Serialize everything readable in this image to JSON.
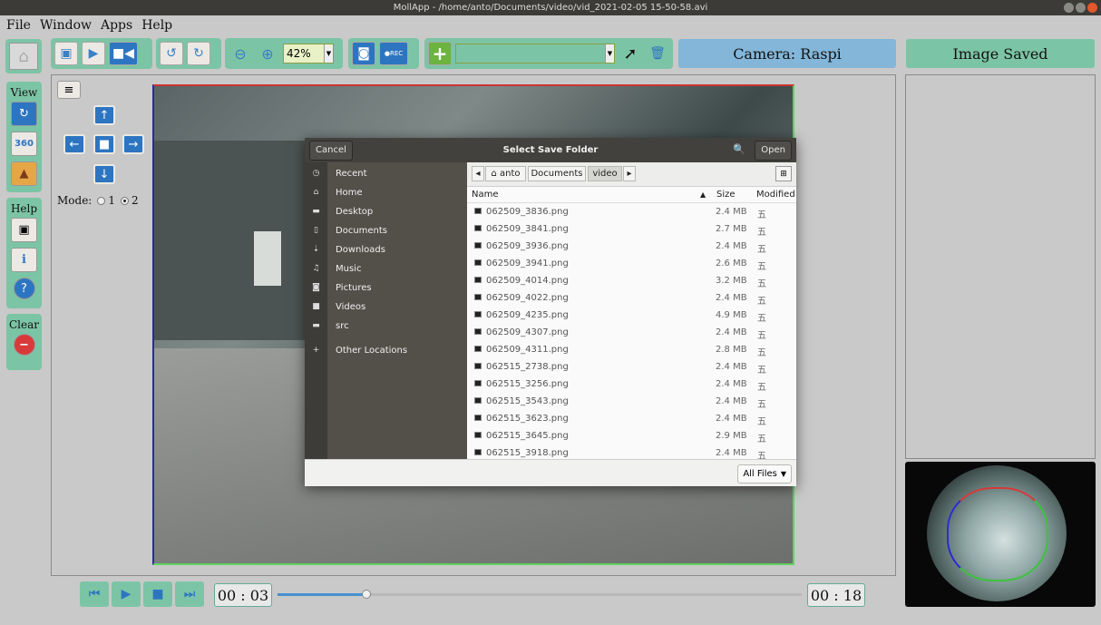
{
  "window": {
    "title": "MollApp - /home/anto/Documents/video/vid_2021-02-05 15-50-58.avi"
  },
  "menu": [
    "File",
    "Window",
    "Apps",
    "Help"
  ],
  "toolbar": {
    "zoom_value": "42%",
    "camera_label": "Camera: Raspi",
    "status_label": "Image Saved",
    "accent_color": "#7cc4a6",
    "blue_color": "#2d75c1"
  },
  "sidebar": {
    "view_title": "View",
    "help_title": "Help",
    "clear_title": "Clear",
    "badge_360": "360"
  },
  "mode": {
    "label": "Mode:",
    "option1": "1",
    "option2": "2",
    "selected": "2"
  },
  "player": {
    "current_time": "00 : 03",
    "total_time": "00 : 18",
    "progress": 0.17
  },
  "dialog": {
    "title": "Select Save Folder",
    "cancel": "Cancel",
    "open": "Open",
    "places": [
      {
        "label": "Recent",
        "icon": "clock-icon"
      },
      {
        "label": "Home",
        "icon": "home-icon"
      },
      {
        "label": "Desktop",
        "icon": "folder-icon"
      },
      {
        "label": "Documents",
        "icon": "document-icon"
      },
      {
        "label": "Downloads",
        "icon": "download-icon"
      },
      {
        "label": "Music",
        "icon": "music-icon"
      },
      {
        "label": "Pictures",
        "icon": "camera-icon"
      },
      {
        "label": "Videos",
        "icon": "video-icon"
      },
      {
        "label": "src",
        "icon": "folder-icon"
      },
      {
        "label": "Other Locations",
        "icon": "plus-icon"
      }
    ],
    "path": [
      "anto",
      "Documents",
      "video"
    ],
    "columns": {
      "name": "Name",
      "size": "Size",
      "modified": "Modified"
    },
    "files": [
      {
        "name": "062509_3836.png",
        "size": "2.4 MB",
        "modified": "五"
      },
      {
        "name": "062509_3841.png",
        "size": "2.7 MB",
        "modified": "五"
      },
      {
        "name": "062509_3936.png",
        "size": "2.4 MB",
        "modified": "五"
      },
      {
        "name": "062509_3941.png",
        "size": "2.6 MB",
        "modified": "五"
      },
      {
        "name": "062509_4014.png",
        "size": "3.2 MB",
        "modified": "五"
      },
      {
        "name": "062509_4022.png",
        "size": "2.4 MB",
        "modified": "五"
      },
      {
        "name": "062509_4235.png",
        "size": "4.9 MB",
        "modified": "五"
      },
      {
        "name": "062509_4307.png",
        "size": "2.4 MB",
        "modified": "五"
      },
      {
        "name": "062509_4311.png",
        "size": "2.8 MB",
        "modified": "五"
      },
      {
        "name": "062515_2738.png",
        "size": "2.4 MB",
        "modified": "五"
      },
      {
        "name": "062515_3256.png",
        "size": "2.4 MB",
        "modified": "五"
      },
      {
        "name": "062515_3543.png",
        "size": "2.4 MB",
        "modified": "五"
      },
      {
        "name": "062515_3623.png",
        "size": "2.4 MB",
        "modified": "五"
      },
      {
        "name": "062515_3645.png",
        "size": "2.9 MB",
        "modified": "五"
      },
      {
        "name": "062515_3918.png",
        "size": "2.4 MB",
        "modified": "五"
      }
    ],
    "filter": "All Files"
  }
}
